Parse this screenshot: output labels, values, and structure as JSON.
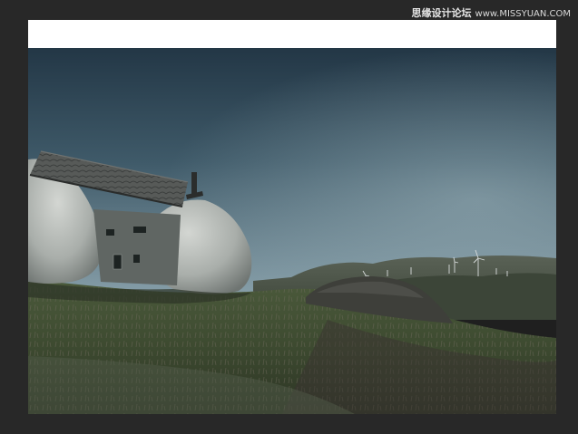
{
  "watermark": {
    "cn_text": "思缘设计论坛",
    "url_text": "www.MISSYUAN.COM"
  },
  "canvas": {
    "band_color": "#ffffff",
    "sky_top": "#29404f",
    "sky_bottom": "#7d95a0",
    "ground_color": "#3e4a33"
  }
}
